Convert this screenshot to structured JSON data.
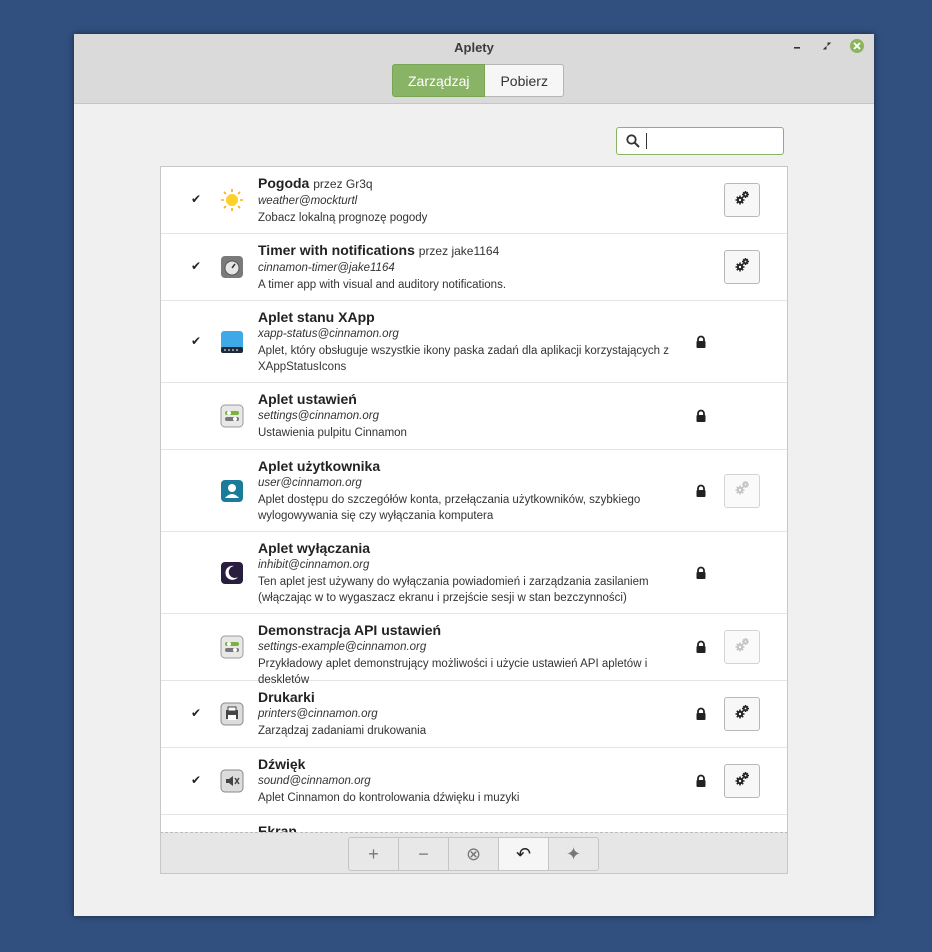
{
  "window": {
    "title": "Aplety"
  },
  "tabs": [
    {
      "label": "Zarządzaj"
    },
    {
      "label": "Pobierz"
    }
  ],
  "search": {
    "value": ""
  },
  "applets": [
    {
      "name": "Pogoda",
      "author": "przez Gr3q",
      "uuid": "weather@mockturtl",
      "desc": "Zobacz lokalną prognozę pogody",
      "enabled": true,
      "locked": false,
      "configure": "enabled",
      "icon": "sun-icon"
    },
    {
      "name": "Timer with notifications",
      "author": "przez jake1164",
      "uuid": "cinnamon-timer@jake1164",
      "desc": "A timer app with visual and auditory notifications.",
      "enabled": true,
      "locked": false,
      "configure": "enabled",
      "icon": "timer-icon"
    },
    {
      "name": "Aplet stanu XApp",
      "author": "",
      "uuid": "xapp-status@cinnamon.org",
      "desc": "Aplet, który obsługuje wszystkie ikony paska zadań dla aplikacji korzystających z XAppStatusIcons",
      "enabled": true,
      "locked": true,
      "configure": "none",
      "icon": "panel-icon"
    },
    {
      "name": "Aplet ustawień",
      "author": "",
      "uuid": "settings@cinnamon.org",
      "desc": "Ustawienia pulpitu Cinnamon",
      "enabled": false,
      "locked": true,
      "configure": "none",
      "icon": "toggles-icon"
    },
    {
      "name": "Aplet użytkownika",
      "author": "",
      "uuid": "user@cinnamon.org",
      "desc": "Aplet dostępu do szczegółów konta, przełączania użytkowników, szybkiego wylogowywania się czy wyłączania komputera",
      "enabled": false,
      "locked": true,
      "configure": "disabled",
      "icon": "user-icon"
    },
    {
      "name": "Aplet wyłączania",
      "author": "",
      "uuid": "inhibit@cinnamon.org",
      "desc": "Ten aplet jest używany do wyłączania powiadomień i zarządzania zasilaniem (włączając w to wygaszacz ekranu i przejście sesji w stan bezczynności)",
      "enabled": false,
      "locked": true,
      "configure": "none",
      "icon": "moon-icon"
    },
    {
      "name": "Demonstracja API ustawień",
      "author": "",
      "uuid": "settings-example@cinnamon.org",
      "desc": "Przykładowy aplet demonstrujący możliwości i użycie ustawień API apletów i deskletów",
      "enabled": false,
      "locked": true,
      "configure": "disabled",
      "icon": "toggles-icon"
    },
    {
      "name": "Drukarki",
      "author": "",
      "uuid": "printers@cinnamon.org",
      "desc": "Zarządzaj zadaniami drukowania",
      "enabled": true,
      "locked": true,
      "configure": "enabled",
      "icon": "printer-icon"
    },
    {
      "name": "Dźwięk",
      "author": "",
      "uuid": "sound@cinnamon.org",
      "desc": "Aplet Cinnamon do kontrolowania dźwięku i muzyki",
      "enabled": true,
      "locked": true,
      "configure": "enabled",
      "icon": "speaker-icon"
    },
    {
      "name": "Ekran",
      "author": "",
      "uuid": "",
      "desc": "",
      "enabled": false,
      "locked": false,
      "configure": "none",
      "icon": ""
    }
  ],
  "toolbar": {
    "buttons": [
      {
        "icon": "plus-icon",
        "glyph": "+"
      },
      {
        "icon": "minus-icon",
        "glyph": "−"
      },
      {
        "icon": "clear-icon",
        "glyph": "⊗"
      },
      {
        "icon": "undo-icon",
        "glyph": "↶"
      },
      {
        "icon": "sparkle-icon",
        "glyph": "✦"
      }
    ]
  },
  "colors": {
    "accent": "#8ab465",
    "desktop": "#31507f"
  }
}
